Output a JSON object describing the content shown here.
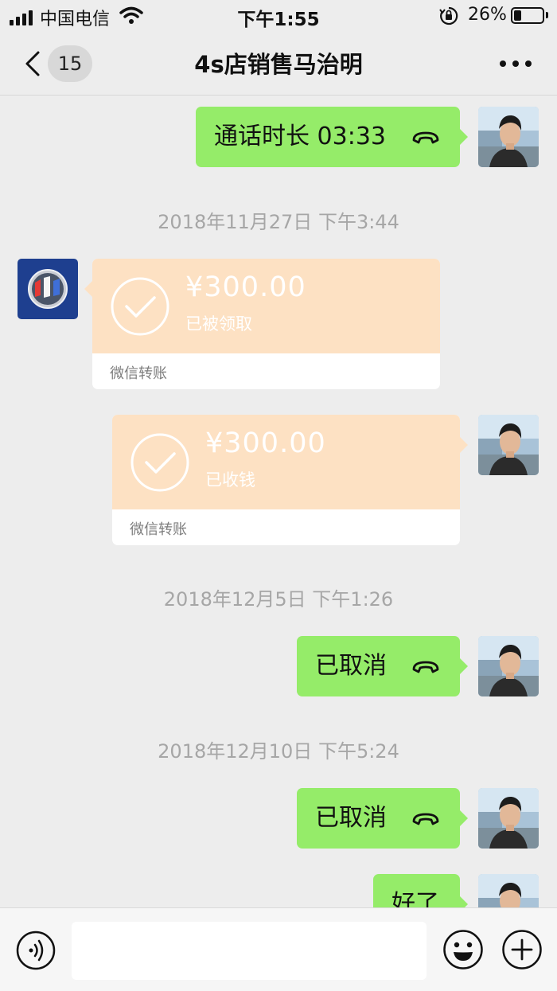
{
  "status_bar": {
    "carrier": "中国电信",
    "time": "下午1:55",
    "battery_percent": "26%",
    "battery_level": 0.26
  },
  "nav": {
    "unread_count": "15",
    "title": "4s店销售马治明"
  },
  "messages": [
    {
      "type": "call",
      "sender": "me",
      "text": "通话时长 03:33",
      "icon": "phone-hangup-icon"
    },
    {
      "type": "timestamp",
      "text": "2018年11月27日 下午3:44"
    },
    {
      "type": "transfer",
      "sender": "other",
      "amount": "¥300.00",
      "status": "已被领取",
      "label": "微信转账",
      "icon": "checkmark-circle-icon"
    },
    {
      "type": "transfer",
      "sender": "me",
      "amount": "¥300.00",
      "status": "已收钱",
      "label": "微信转账",
      "icon": "checkmark-circle-icon"
    },
    {
      "type": "timestamp",
      "text": "2018年12月5日 下午1:26"
    },
    {
      "type": "call",
      "sender": "me",
      "text": "已取消",
      "icon": "phone-hangup-icon"
    },
    {
      "type": "timestamp",
      "text": "2018年12月10日 下午5:24"
    },
    {
      "type": "call",
      "sender": "me",
      "text": "已取消",
      "icon": "phone-hangup-icon"
    },
    {
      "type": "text",
      "sender": "me",
      "text": "好了"
    }
  ],
  "input_bar": {
    "value": ""
  },
  "colors": {
    "sent_bubble": "#95ec69",
    "transfer_orange": "#fde1c3",
    "background": "#ededed",
    "contact_avatar_blue": "#1e3f8f"
  }
}
